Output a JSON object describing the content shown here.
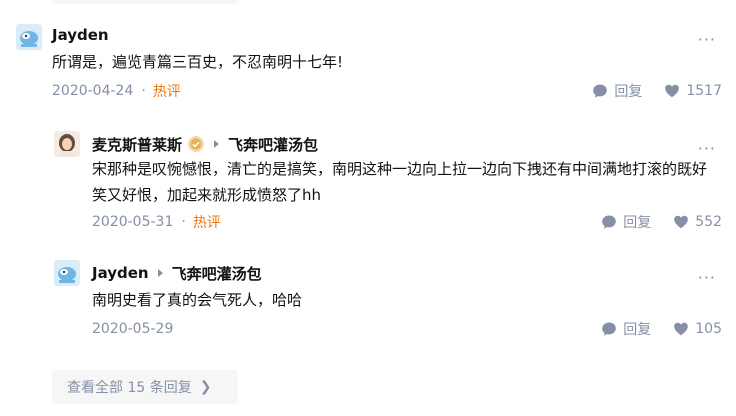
{
  "comments": [
    {
      "author": "Jayden",
      "text": "所谓是，遍览青篇三百史，不忍南明十七年!",
      "date": "2020-04-24",
      "tag": "热评",
      "reply_label": "回复",
      "likes": "1517",
      "more": "···"
    },
    {
      "author": "麦克斯普莱斯",
      "target": "飞奔吧灌汤包",
      "text": "宋那种是叹惋憾恨，清亡的是搞笑，南明这种一边向上拉一边向下拽还有中间满地打滚的既好笑又好恨，加起来就形成愤怒了hh",
      "date": "2020-05-31",
      "tag": "热评",
      "reply_label": "回复",
      "likes": "552",
      "more": "···"
    },
    {
      "author": "Jayden",
      "target": "飞奔吧灌汤包",
      "text": "南明史看了真的会气死人，哈哈",
      "date": "2020-05-29",
      "reply_label": "回复",
      "likes": "105",
      "more": "···"
    }
  ],
  "view_all": {
    "label": "查看全部 15 条回复",
    "chevron": "❯"
  },
  "icons": [
    "reply-bubble-icon",
    "heart-icon",
    "more-icon",
    "chevron-right-icon",
    "medal-badge-icon"
  ],
  "colors": {
    "hot": "#f1760d",
    "meta": "#8590a6",
    "text": "#121212",
    "panel": "#f6f6f6"
  }
}
